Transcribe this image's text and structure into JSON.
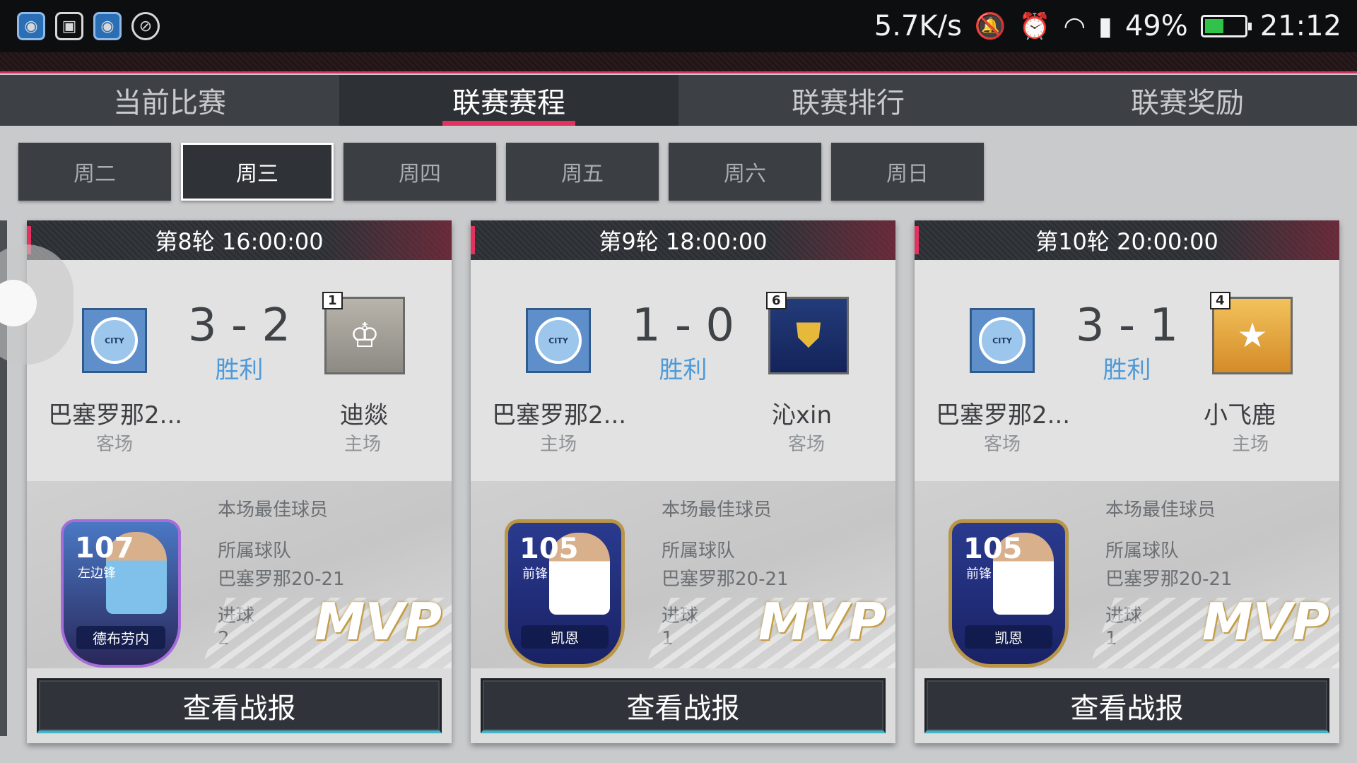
{
  "status_bar": {
    "speed": "5.7K/s",
    "battery": "49%",
    "battery_level": 0.49,
    "time": "21:12",
    "icons": [
      "app-icon",
      "image-icon",
      "app-icon-2",
      "vpn-icon",
      "mute-icon",
      "alarm-icon",
      "wifi-icon",
      "sim-icon",
      "battery-icon"
    ]
  },
  "tabs": [
    {
      "label": "当前比赛",
      "active": false
    },
    {
      "label": "联赛赛程",
      "active": true
    },
    {
      "label": "联赛排行",
      "active": false
    },
    {
      "label": "联赛奖励",
      "active": false
    }
  ],
  "days": [
    {
      "label": "周二",
      "active": false
    },
    {
      "label": "周三",
      "active": true
    },
    {
      "label": "周四",
      "active": false
    },
    {
      "label": "周五",
      "active": false
    },
    {
      "label": "周六",
      "active": false
    },
    {
      "label": "周日",
      "active": false
    }
  ],
  "labels": {
    "mvp_title": "本场最佳球员",
    "team_label": "所属球队",
    "goals_label": "进球",
    "mvp_stamp": "MVP",
    "report_button": "查看战报"
  },
  "matches": [
    {
      "round": "第8轮 16:00:00",
      "score": "3 - 2",
      "result": "胜利",
      "home_name": "巴塞罗那2...",
      "home_venue": "客场",
      "away_name": "迪燚",
      "away_venue": "主场",
      "away_rank": "1",
      "mvp": {
        "rating": "107",
        "position": "左边锋",
        "name": "德布劳内",
        "team": "巴塞罗那20-21",
        "goals": "2"
      }
    },
    {
      "round": "第9轮 18:00:00",
      "score": "1 - 0",
      "result": "胜利",
      "home_name": "巴塞罗那2...",
      "home_venue": "主场",
      "away_name": "沁xin",
      "away_venue": "客场",
      "away_rank": "6",
      "mvp": {
        "rating": "105",
        "position": "前锋",
        "name": "凯恩",
        "team": "巴塞罗那20-21",
        "goals": "1"
      }
    },
    {
      "round": "第10轮 20:00:00",
      "score": "3 - 1",
      "result": "胜利",
      "home_name": "巴塞罗那2...",
      "home_venue": "客场",
      "away_name": "小飞鹿",
      "away_venue": "主场",
      "away_rank": "4",
      "mvp": {
        "rating": "105",
        "position": "前锋",
        "name": "凯恩",
        "team": "巴塞罗那20-21",
        "goals": "1"
      }
    }
  ]
}
